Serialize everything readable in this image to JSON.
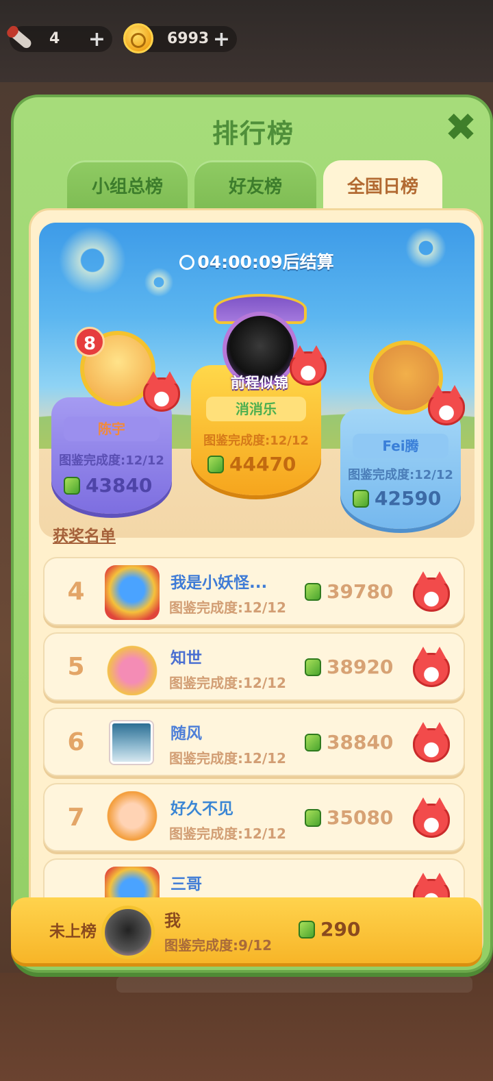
{
  "resources": [
    {
      "icon": "rocket-icon",
      "value": "4",
      "plus": "+"
    },
    {
      "icon": "coin-icon",
      "value": "6993",
      "plus": "+"
    }
  ],
  "panel": {
    "title": "排行榜",
    "close_label": "✖",
    "tabs": [
      {
        "label": "小组总榜",
        "active": false
      },
      {
        "label": "好友榜",
        "active": false
      },
      {
        "label": "全国日榜",
        "active": true
      }
    ]
  },
  "podium": {
    "timer": "04:00:09后结算",
    "first": {
      "title": "前程似锦",
      "name": "消消乐",
      "progress": "图鉴完成度:12/12",
      "score": "44470"
    },
    "second": {
      "badge": "8",
      "name": "陈宇",
      "progress": "图鉴完成度:12/12",
      "score": "43840"
    },
    "third": {
      "name": "Fei腾",
      "progress": "图鉴完成度:12/12",
      "score": "42590"
    }
  },
  "award_link": "获奖名单",
  "list": [
    {
      "rank": "4",
      "name": "我是小妖怪...",
      "progress": "图鉴完成度:12/12",
      "score": "39780",
      "name_color": "#3e7bd6"
    },
    {
      "rank": "5",
      "name": "知世",
      "progress": "图鉴完成度:12/12",
      "score": "38920",
      "name_color": "#4a6fd1"
    },
    {
      "rank": "6",
      "name": "随风",
      "progress": "图鉴完成度:12/12",
      "score": "38840",
      "name_color": "#4d7fd8"
    },
    {
      "rank": "7",
      "name": "好久不见",
      "progress": "图鉴完成度:12/12",
      "score": "35080",
      "name_color": "#3a86d4"
    }
  ],
  "partial_row": {
    "name": "三哥"
  },
  "me": {
    "status": "未上榜",
    "name": "我",
    "progress": "图鉴完成度:9/12",
    "score": "290"
  },
  "colors": {
    "panel_green": "#a6dc7a",
    "tab_active": "#fff4d4",
    "me_bar": "#ffd34d"
  }
}
